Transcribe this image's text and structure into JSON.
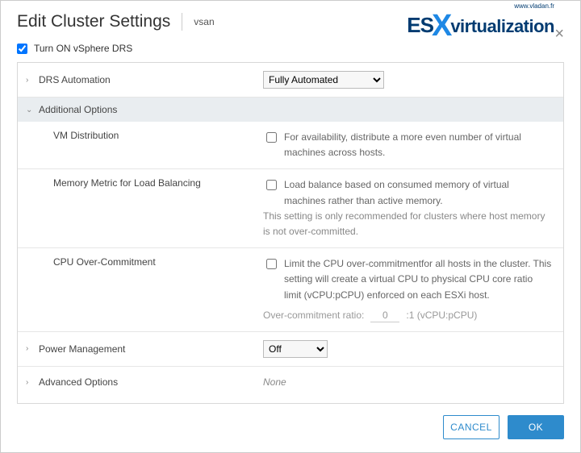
{
  "header": {
    "title": "Edit Cluster Settings",
    "cluster_name": "vsan",
    "logo_es": "ES",
    "logo_x": "X",
    "logo_virt": "virtualization",
    "logo_sub": "www.vladan.fr"
  },
  "turn_on_label": "Turn ON vSphere DRS",
  "turn_on_checked": true,
  "sections": {
    "drs_automation": {
      "label": "DRS Automation",
      "select_value": "Fully Automated"
    },
    "additional_options": {
      "label": "Additional Options",
      "vm_dist": {
        "label": "VM Distribution",
        "desc": "For availability, distribute a more even number of virtual machines across hosts."
      },
      "mem_metric": {
        "label": "Memory Metric for Load Balancing",
        "desc": "Load balance based on consumed memory of virtual machines rather than active memory.",
        "hint": "This setting is only recommended for clusters where host memory is not over-committed."
      },
      "cpu_over": {
        "label": "CPU Over-Commitment",
        "desc": "Limit the CPU over-commitmentfor all hosts in the cluster. This setting will create a virtual CPU to physical CPU core ratio limit (vCPU:pCPU) enforced on each ESXi host.",
        "ratio_label": "Over-commitment ratio:",
        "ratio_value": "0",
        "ratio_suffix": ":1 (vCPU:pCPU)"
      }
    },
    "power_mgmt": {
      "label": "Power Management",
      "select_value": "Off"
    },
    "advanced": {
      "label": "Advanced Options",
      "value": "None"
    }
  },
  "footer": {
    "cancel": "CANCEL",
    "ok": "OK"
  }
}
